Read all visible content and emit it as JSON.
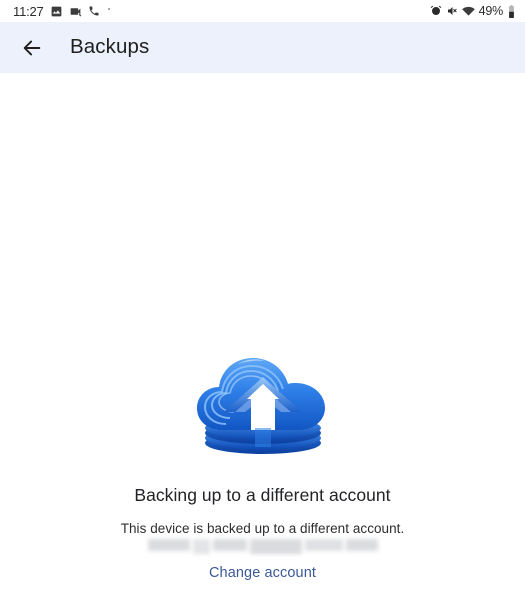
{
  "status_bar": {
    "clock": "11:27",
    "left_icons": [
      {
        "name": "image-icon",
        "label": "photo"
      },
      {
        "name": "screenshot-icon",
        "label": "screenshot"
      },
      {
        "name": "phone-call-icon",
        "label": "call"
      },
      {
        "name": "more-dot-icon",
        "label": "more"
      }
    ],
    "right_icons": [
      {
        "name": "alarm-clock-icon",
        "label": "alarm"
      },
      {
        "name": "volume-mute-icon",
        "label": "muted"
      },
      {
        "name": "wifi-icon",
        "label": "wifi"
      }
    ],
    "battery_percent": "49%",
    "battery_icon": "battery-icon"
  },
  "app_bar": {
    "back_icon": "back-arrow-icon",
    "title": "Backups",
    "background_color": "#ecf1fb"
  },
  "main": {
    "illustration": "cloud-upload-icon",
    "headline": "Backing up to a different account",
    "subtext": "This device is backed up to a different account.",
    "account_redacted": true,
    "change_account_label": "Change account",
    "link_color": "#3b5998"
  }
}
